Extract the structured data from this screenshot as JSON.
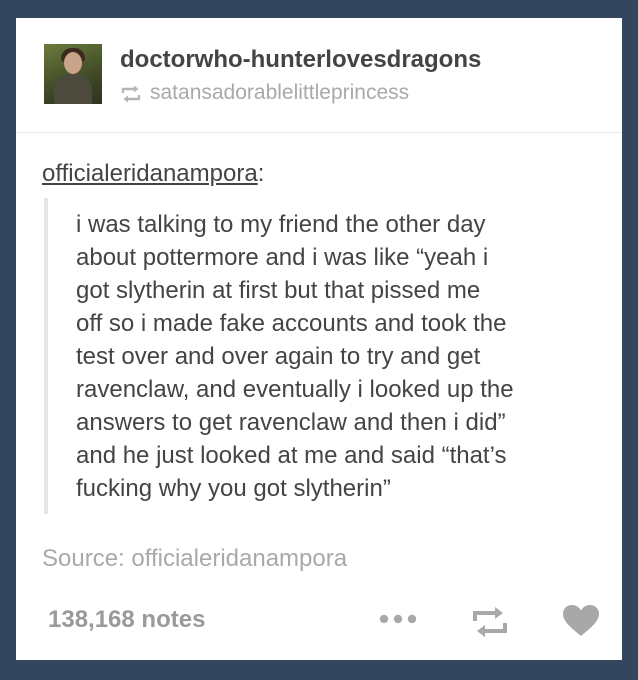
{
  "post": {
    "blog_name": "doctorwho-hunterlovesdragons",
    "reblogged_from": "satansadorablelittleprincess",
    "quote_author": "officialeridanampora",
    "quote_author_colon": ":",
    "quote_lines": [
      "i was talking to my friend the other day",
      "about pottermore and i was like “yeah i",
      "got slytherin at first but that pissed me",
      "off so i made fake accounts and took the",
      "test over and over again to try and get",
      "ravenclaw, and eventually i looked up the",
      "answers to get ravenclaw and then i did”",
      "and he just looked at me and said “that’s",
      "fucking why you got slytherin”"
    ],
    "source_label": "Source: officialeridanampora",
    "notes_count": "138,168 notes"
  },
  "icons": {
    "reblog_small": "reblog-icon",
    "more": "more-icon",
    "reblog": "reblog-icon",
    "like": "heart-icon"
  },
  "colors": {
    "background": "#34465d",
    "card": "#ffffff",
    "text": "#444444",
    "muted": "#a9a9a9",
    "icon": "#a0a0a0"
  }
}
